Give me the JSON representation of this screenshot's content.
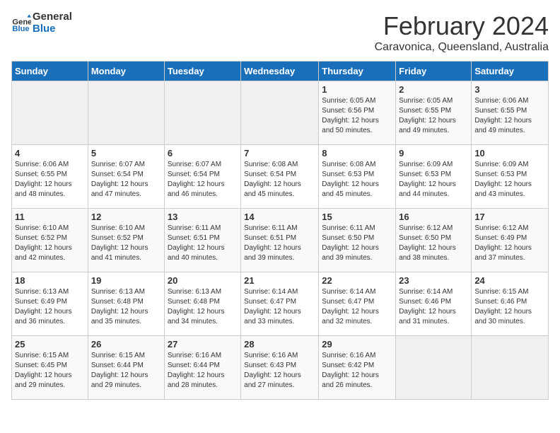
{
  "logo": {
    "line1": "General",
    "line2": "Blue"
  },
  "title": "February 2024",
  "subtitle": "Caravonica, Queensland, Australia",
  "weekdays": [
    "Sunday",
    "Monday",
    "Tuesday",
    "Wednesday",
    "Thursday",
    "Friday",
    "Saturday"
  ],
  "weeks": [
    [
      {
        "day": "",
        "detail": ""
      },
      {
        "day": "",
        "detail": ""
      },
      {
        "day": "",
        "detail": ""
      },
      {
        "day": "",
        "detail": ""
      },
      {
        "day": "1",
        "detail": "Sunrise: 6:05 AM\nSunset: 6:56 PM\nDaylight: 12 hours\nand 50 minutes."
      },
      {
        "day": "2",
        "detail": "Sunrise: 6:05 AM\nSunset: 6:55 PM\nDaylight: 12 hours\nand 49 minutes."
      },
      {
        "day": "3",
        "detail": "Sunrise: 6:06 AM\nSunset: 6:55 PM\nDaylight: 12 hours\nand 49 minutes."
      }
    ],
    [
      {
        "day": "4",
        "detail": "Sunrise: 6:06 AM\nSunset: 6:55 PM\nDaylight: 12 hours\nand 48 minutes."
      },
      {
        "day": "5",
        "detail": "Sunrise: 6:07 AM\nSunset: 6:54 PM\nDaylight: 12 hours\nand 47 minutes."
      },
      {
        "day": "6",
        "detail": "Sunrise: 6:07 AM\nSunset: 6:54 PM\nDaylight: 12 hours\nand 46 minutes."
      },
      {
        "day": "7",
        "detail": "Sunrise: 6:08 AM\nSunset: 6:54 PM\nDaylight: 12 hours\nand 45 minutes."
      },
      {
        "day": "8",
        "detail": "Sunrise: 6:08 AM\nSunset: 6:53 PM\nDaylight: 12 hours\nand 45 minutes."
      },
      {
        "day": "9",
        "detail": "Sunrise: 6:09 AM\nSunset: 6:53 PM\nDaylight: 12 hours\nand 44 minutes."
      },
      {
        "day": "10",
        "detail": "Sunrise: 6:09 AM\nSunset: 6:53 PM\nDaylight: 12 hours\nand 43 minutes."
      }
    ],
    [
      {
        "day": "11",
        "detail": "Sunrise: 6:10 AM\nSunset: 6:52 PM\nDaylight: 12 hours\nand 42 minutes."
      },
      {
        "day": "12",
        "detail": "Sunrise: 6:10 AM\nSunset: 6:52 PM\nDaylight: 12 hours\nand 41 minutes."
      },
      {
        "day": "13",
        "detail": "Sunrise: 6:11 AM\nSunset: 6:51 PM\nDaylight: 12 hours\nand 40 minutes."
      },
      {
        "day": "14",
        "detail": "Sunrise: 6:11 AM\nSunset: 6:51 PM\nDaylight: 12 hours\nand 39 minutes."
      },
      {
        "day": "15",
        "detail": "Sunrise: 6:11 AM\nSunset: 6:50 PM\nDaylight: 12 hours\nand 39 minutes."
      },
      {
        "day": "16",
        "detail": "Sunrise: 6:12 AM\nSunset: 6:50 PM\nDaylight: 12 hours\nand 38 minutes."
      },
      {
        "day": "17",
        "detail": "Sunrise: 6:12 AM\nSunset: 6:49 PM\nDaylight: 12 hours\nand 37 minutes."
      }
    ],
    [
      {
        "day": "18",
        "detail": "Sunrise: 6:13 AM\nSunset: 6:49 PM\nDaylight: 12 hours\nand 36 minutes."
      },
      {
        "day": "19",
        "detail": "Sunrise: 6:13 AM\nSunset: 6:48 PM\nDaylight: 12 hours\nand 35 minutes."
      },
      {
        "day": "20",
        "detail": "Sunrise: 6:13 AM\nSunset: 6:48 PM\nDaylight: 12 hours\nand 34 minutes."
      },
      {
        "day": "21",
        "detail": "Sunrise: 6:14 AM\nSunset: 6:47 PM\nDaylight: 12 hours\nand 33 minutes."
      },
      {
        "day": "22",
        "detail": "Sunrise: 6:14 AM\nSunset: 6:47 PM\nDaylight: 12 hours\nand 32 minutes."
      },
      {
        "day": "23",
        "detail": "Sunrise: 6:14 AM\nSunset: 6:46 PM\nDaylight: 12 hours\nand 31 minutes."
      },
      {
        "day": "24",
        "detail": "Sunrise: 6:15 AM\nSunset: 6:46 PM\nDaylight: 12 hours\nand 30 minutes."
      }
    ],
    [
      {
        "day": "25",
        "detail": "Sunrise: 6:15 AM\nSunset: 6:45 PM\nDaylight: 12 hours\nand 29 minutes."
      },
      {
        "day": "26",
        "detail": "Sunrise: 6:15 AM\nSunset: 6:44 PM\nDaylight: 12 hours\nand 29 minutes."
      },
      {
        "day": "27",
        "detail": "Sunrise: 6:16 AM\nSunset: 6:44 PM\nDaylight: 12 hours\nand 28 minutes."
      },
      {
        "day": "28",
        "detail": "Sunrise: 6:16 AM\nSunset: 6:43 PM\nDaylight: 12 hours\nand 27 minutes."
      },
      {
        "day": "29",
        "detail": "Sunrise: 6:16 AM\nSunset: 6:42 PM\nDaylight: 12 hours\nand 26 minutes."
      },
      {
        "day": "",
        "detail": ""
      },
      {
        "day": "",
        "detail": ""
      }
    ]
  ]
}
